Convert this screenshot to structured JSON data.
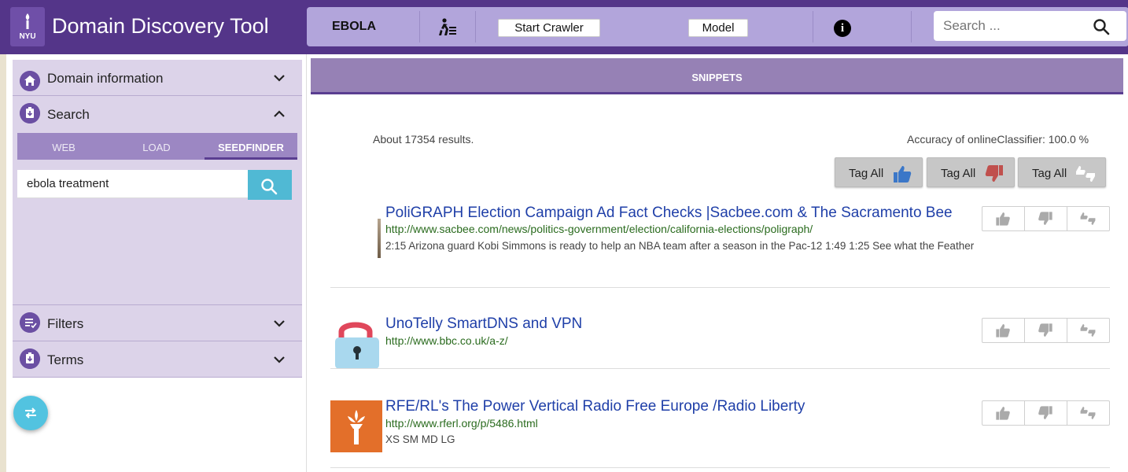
{
  "app": {
    "logo_text": "NYU",
    "title": "Domain Discovery Tool"
  },
  "toolbar": {
    "domain": "EBOLA",
    "crawler_icon": "crawler-runner-icon",
    "start_crawler": "Start Crawler",
    "model": "Model",
    "info_icon": "i",
    "search_placeholder": "Search ..."
  },
  "sidebar": {
    "panels": [
      {
        "label": "Domain information",
        "icon": "home-icon",
        "expanded": false
      },
      {
        "label": "Search",
        "icon": "search-clip-icon",
        "expanded": true
      },
      {
        "label": "Filters",
        "icon": "filter-list-icon",
        "expanded": false
      },
      {
        "label": "Terms",
        "icon": "terms-clip-icon",
        "expanded": false
      }
    ],
    "search_tabs": [
      "WEB",
      "LOAD",
      "SEEDFINDER"
    ],
    "active_tab": "SEEDFINDER",
    "query_value": "ebola treatment"
  },
  "main": {
    "tab_label": "SNIPPETS",
    "results_count": "About 17354 results.",
    "accuracy": "Accuracy of onlineClassifier: 100.0 %",
    "tag_all": [
      {
        "label": "Tag All",
        "icon": "thumbs-up-icon",
        "color": "#3b77c8"
      },
      {
        "label": "Tag All",
        "icon": "thumbs-down-icon",
        "color": "#c0504d"
      },
      {
        "label": "Tag All",
        "icon": "neutral-thumbs-icon",
        "color": "#ffffff"
      }
    ],
    "results": [
      {
        "title": "PoliGRAPH Election Campaign Ad Fact Checks |Sacbee.com & The Sacramento Bee",
        "url": "http://www.sacbee.com/news/politics-government/election/california-elections/poligraph/",
        "description": "2:15 Arizona guard Kobi Simmons is ready to help an NBA team after a season in the Pac-12 1:49 1:25 See what the Feather"
      },
      {
        "title": "UnoTelly SmartDNS and VPN",
        "url": "http://www.bbc.co.uk/a-z/",
        "description": ""
      },
      {
        "title": "RFE/RL's The Power Vertical Radio Free Europe /Radio Liberty",
        "url": "http://www.rferl.org/p/5486.html",
        "description": "XS SM MD LG"
      }
    ]
  },
  "colors": {
    "header": "#543589",
    "toolbar": "#b2a5db",
    "panel": "#dcd3e9",
    "accent": "#50b9d4",
    "link": "#1f3fa8",
    "url": "#2a6b1e"
  }
}
